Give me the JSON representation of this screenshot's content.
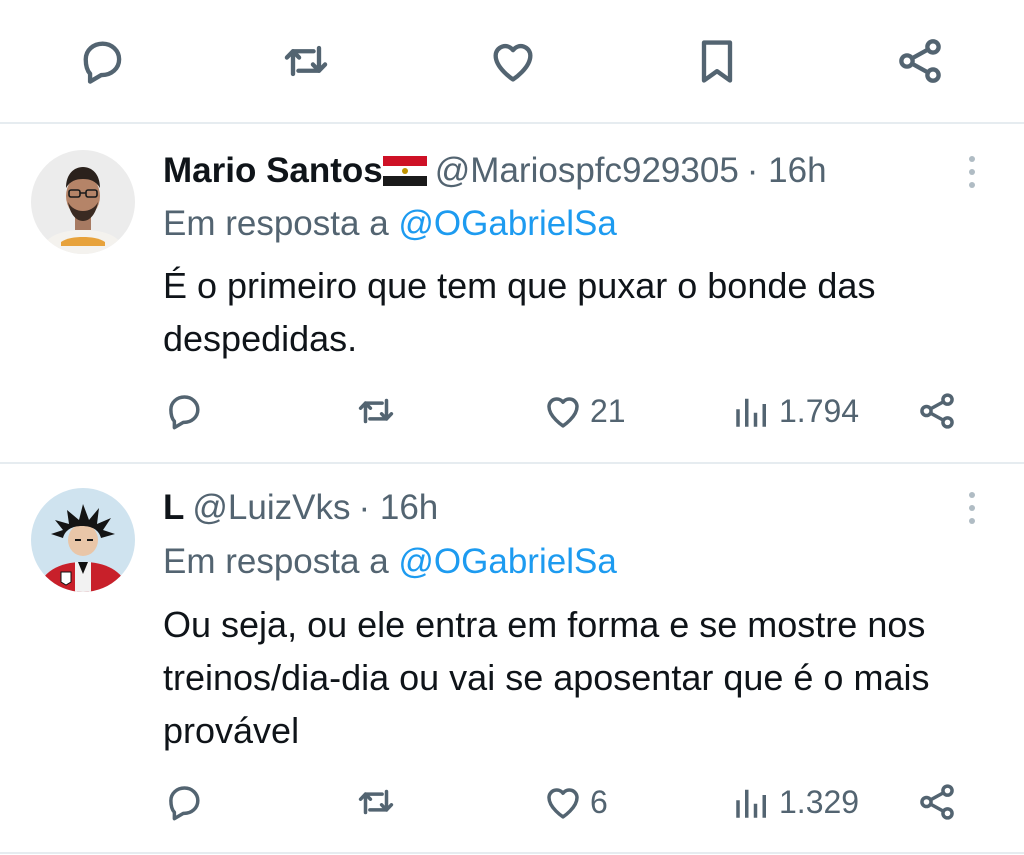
{
  "top_actions": [
    "reply-icon",
    "retweet-icon",
    "like-icon",
    "bookmark-icon",
    "share-icon"
  ],
  "tweets": [
    {
      "name": "Mario Santos",
      "handle": "@Mariospfc929305",
      "time": "· 16h",
      "reply_prefix": "Em resposta a ",
      "reply_to": "@OGabrielSa",
      "text": "É o primeiro que tem que puxar o bonde das despedidas.",
      "likes": "21",
      "views": "1.794"
    },
    {
      "name": "L",
      "handle": "@LuizVks",
      "time": "· 16h",
      "reply_prefix": "Em resposta a ",
      "reply_to": "@OGabrielSa",
      "text": "Ou seja, ou ele entra em forma e se mostre nos treinos/dia-dia ou vai se aposentar que é o mais provável",
      "likes": "6",
      "views": "1.329"
    }
  ],
  "colors": {
    "text": "#0f1419",
    "secondary": "#536471",
    "mention": "#1d9bf0",
    "divider": "#e6ecf0"
  }
}
